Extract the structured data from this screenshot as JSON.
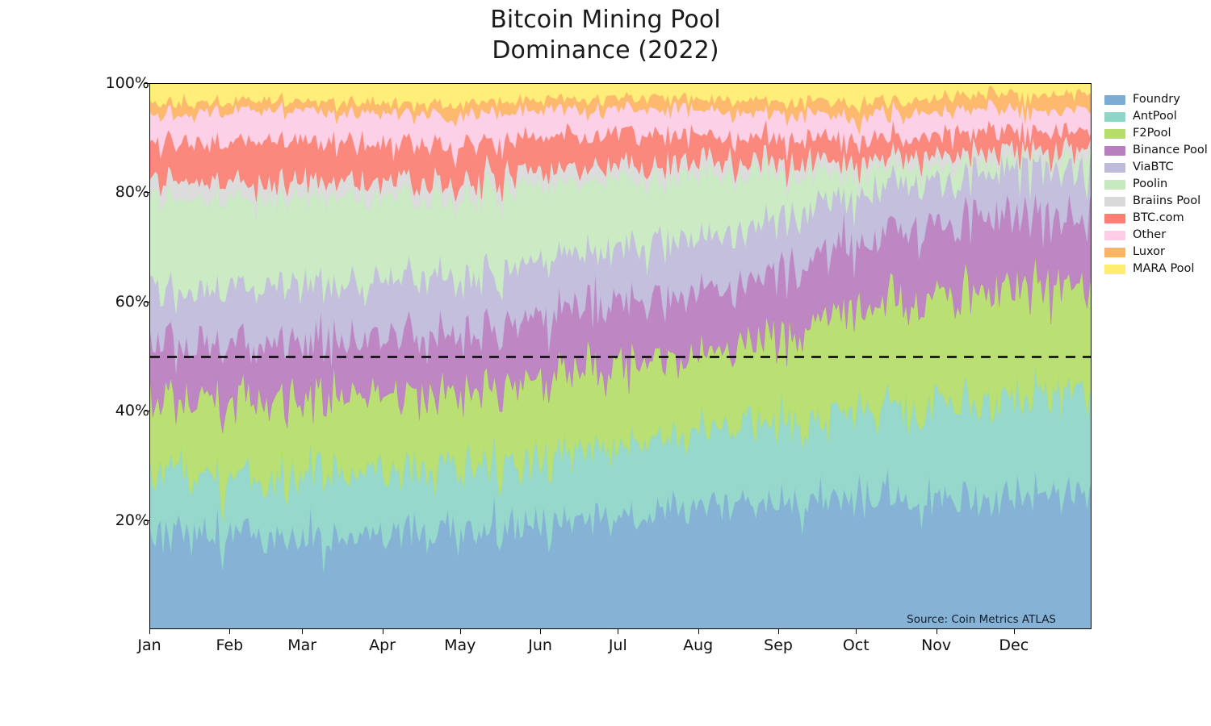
{
  "title": {
    "line1": "Bitcoin Mining Pool",
    "line2": "Dominance (2022)"
  },
  "source_note": "Source: Coin Metrics ATLAS",
  "axes": {
    "y_ticks": [
      "20%",
      "40%",
      "60%",
      "80%",
      "100%"
    ],
    "y_tick_values": [
      20,
      40,
      60,
      80,
      100
    ],
    "x_ticks": [
      "Jan",
      "Feb",
      "Mar",
      "Apr",
      "May",
      "Jun",
      "Jul",
      "Aug",
      "Sep",
      "Oct",
      "Nov",
      "Dec"
    ],
    "ylim": [
      0,
      100
    ],
    "xlabel": "",
    "ylabel": ""
  },
  "reference_line": {
    "value": 50,
    "style": "dashed",
    "color": "#000000"
  },
  "legend": {
    "position": "right",
    "items": [
      {
        "label": "Foundry",
        "color": "#7DACD3"
      },
      {
        "label": "AntPool",
        "color": "#8ED6C8"
      },
      {
        "label": "F2Pool",
        "color": "#B5DE68"
      },
      {
        "label": "Binance Pool",
        "color": "#B97EC0"
      },
      {
        "label": "ViaBTC",
        "color": "#BEBADA"
      },
      {
        "label": "Poolin",
        "color": "#C7E9C0"
      },
      {
        "label": "Braiins Pool",
        "color": "#D9D9D9"
      },
      {
        "label": "BTC.com",
        "color": "#FB7F72"
      },
      {
        "label": "Other",
        "color": "#FCCDE5"
      },
      {
        "label": "Luxor",
        "color": "#FDB462"
      },
      {
        "label": "MARA Pool",
        "color": "#FFED6F"
      }
    ]
  },
  "chart_data": {
    "type": "area",
    "stacked": true,
    "normalized_percent": true,
    "title": "Bitcoin Mining Pool Dominance (2022)",
    "xlabel": "",
    "ylabel": "",
    "ylim": [
      0,
      100
    ],
    "grid": false,
    "x_unit": "day",
    "x_period": "2022-01-01 to 2022-12-31",
    "categories": [
      "Jan",
      "Feb",
      "Mar",
      "Apr",
      "May",
      "Jun",
      "Jul",
      "Aug",
      "Sep",
      "Oct",
      "Nov",
      "Dec"
    ],
    "note": "series values are monthly mean share in percent; daily data is noisy around these means",
    "series": [
      {
        "name": "Foundry",
        "color": "#7DACD3",
        "values": [
          17.5,
          17.0,
          17.5,
          18.0,
          18.5,
          19.5,
          21.5,
          23.5,
          23.5,
          24.0,
          24.5,
          25.0
        ],
        "noise": 5.0
      },
      {
        "name": "AntPool",
        "color": "#8ED6C8",
        "values": [
          10.5,
          11.0,
          11.5,
          11.0,
          11.5,
          12.5,
          13.5,
          14.0,
          15.5,
          16.5,
          17.5,
          18.5
        ],
        "noise": 4.2
      },
      {
        "name": "F2Pool",
        "color": "#B5DE68",
        "values": [
          14.0,
          14.5,
          14.0,
          14.0,
          14.0,
          14.5,
          14.5,
          14.0,
          17.5,
          19.5,
          20.5,
          19.5
        ],
        "noise": 4.8
      },
      {
        "name": "Binance Pool",
        "color": "#B97EC0",
        "values": [
          10.5,
          10.0,
          10.5,
          10.5,
          11.0,
          11.5,
          11.5,
          11.5,
          12.0,
          12.5,
          13.5,
          13.0
        ],
        "noise": 3.8
      },
      {
        "name": "ViaBTC",
        "color": "#BEBADA",
        "values": [
          10.0,
          10.5,
          10.0,
          10.5,
          10.5,
          10.0,
          9.5,
          10.0,
          9.0,
          8.5,
          8.0,
          8.5
        ],
        "noise": 3.4
      },
      {
        "name": "Poolin",
        "color": "#C7E9C0",
        "values": [
          16.5,
          16.0,
          15.5,
          15.0,
          14.5,
          13.5,
          12.0,
          10.5,
          6.0,
          3.0,
          2.0,
          1.8
        ],
        "noise": 3.6
      },
      {
        "name": "Braiins Pool",
        "color": "#D9D9D9",
        "values": [
          3.2,
          3.0,
          3.0,
          2.8,
          2.8,
          2.6,
          2.5,
          2.4,
          2.2,
          2.0,
          1.9,
          1.8
        ],
        "noise": 1.4
      },
      {
        "name": "BTC.com",
        "color": "#FB7F72",
        "values": [
          7.0,
          7.5,
          7.5,
          7.0,
          6.5,
          6.0,
          5.5,
          4.5,
          4.0,
          3.5,
          3.5,
          3.2
        ],
        "noise": 2.6
      },
      {
        "name": "Other",
        "color": "#FCCDE5",
        "values": [
          5.5,
          5.5,
          5.5,
          5.5,
          5.5,
          5.0,
          4.5,
          4.5,
          4.5,
          4.5,
          4.0,
          4.0
        ],
        "noise": 2.0
      },
      {
        "name": "Luxor",
        "color": "#FDB462",
        "values": [
          1.8,
          1.8,
          1.8,
          1.9,
          2.0,
          2.1,
          2.2,
          2.2,
          2.4,
          2.6,
          2.7,
          2.8
        ],
        "noise": 1.1
      },
      {
        "name": "MARA Pool",
        "color": "#FFED6F",
        "values": [
          3.5,
          3.2,
          3.2,
          3.8,
          3.2,
          2.8,
          2.8,
          2.9,
          3.4,
          3.4,
          1.9,
          1.9
        ],
        "noise": 1.5
      }
    ]
  }
}
